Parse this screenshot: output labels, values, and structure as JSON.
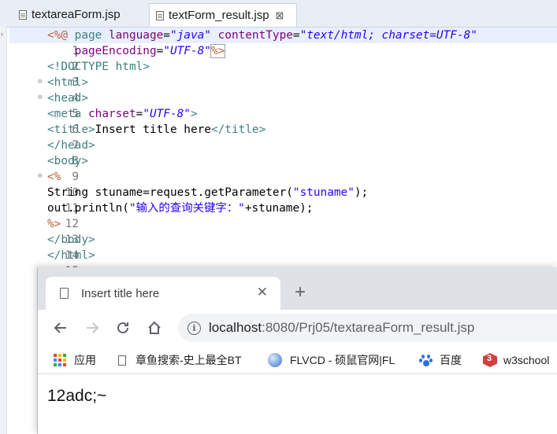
{
  "editor": {
    "tabs": [
      {
        "label": "textareaForm.jsp",
        "active": false
      },
      {
        "label": "textForm_result.jsp",
        "active": true,
        "close": "⊠"
      }
    ],
    "lines": [
      {
        "n": "1",
        "fold": ""
      },
      {
        "n": "2",
        "fold": ""
      },
      {
        "n": "3",
        "fold": ""
      },
      {
        "n": "4",
        "fold": "⊖"
      },
      {
        "n": "5",
        "fold": "⊖"
      },
      {
        "n": "6",
        "fold": ""
      },
      {
        "n": "7",
        "fold": ""
      },
      {
        "n": "8",
        "fold": ""
      },
      {
        "n": "9",
        "fold": ""
      },
      {
        "n": "10",
        "fold": "⊖"
      },
      {
        "n": "11",
        "fold": ""
      },
      {
        "n": "12",
        "fold": ""
      },
      {
        "n": "13",
        "fold": ""
      },
      {
        "n": "14",
        "fold": ""
      },
      {
        "n": "15",
        "fold": ""
      }
    ],
    "code": {
      "l1": {
        "open": "<%@",
        "page": " page ",
        "lang_attr": "language",
        "eq1": "=",
        "lang_val": "\"java\"",
        "ct_attr": " contentType",
        "eq2": "=",
        "ct_val": "\"text/html; charset=UTF-8\""
      },
      "l2": {
        "indent": "    ",
        "pe_attr": "pageEncoding",
        "eq": "=",
        "pe_val": "\"UTF-8\"",
        "close": "%>"
      },
      "l3": "<!DOCTYPE html>",
      "l4": "<html>",
      "l5": "<head>",
      "l6": {
        "open": "<meta",
        "attr": " charset",
        "eq": "=",
        "val": "\"UTF-8\"",
        "close": ">"
      },
      "l7": {
        "open": "<title>",
        "text": "Insert title here",
        "close": "</title>"
      },
      "l8": "</head>",
      "l9": "<body>",
      "l10": "<%",
      "l11": {
        "pre": "String stuname=request.getParameter(",
        "str": "\"stuname\"",
        "post": ");"
      },
      "l12": {
        "pre": "out.println(",
        "str": "\"输入的查询关键字：\"",
        "post": "+stuname);"
      },
      "l13": "%>",
      "l14": "</body>",
      "l15": "</html>"
    }
  },
  "browser": {
    "tab_title": "Insert title here",
    "tab_close": "✕",
    "new_tab": "+",
    "url_host": "localhost",
    "url_rest": ":8080/Prj05/textareaForm_result.jsp",
    "info_icon": "i",
    "bookmarks": [
      {
        "label": "应用",
        "icon": "apps-icon"
      },
      {
        "label": "章鱼搜索-史上最全BT",
        "icon": "page-icon"
      },
      {
        "label": "FLVCD - 硕鼠官网|FL",
        "icon": "globe-icon"
      },
      {
        "label": "百度",
        "icon": "baidu-paw-icon"
      },
      {
        "label": "w3school",
        "icon": "w3school-icon"
      }
    ],
    "page_content": "12adc;~"
  },
  "colors": {
    "directive": "#bf5f3f",
    "keyword": "#3f7f7f",
    "attribute": "#7f007f",
    "value": "#2a00ff",
    "tab_bar": "#dee1e6",
    "omnibox": "#f1f3f4"
  }
}
